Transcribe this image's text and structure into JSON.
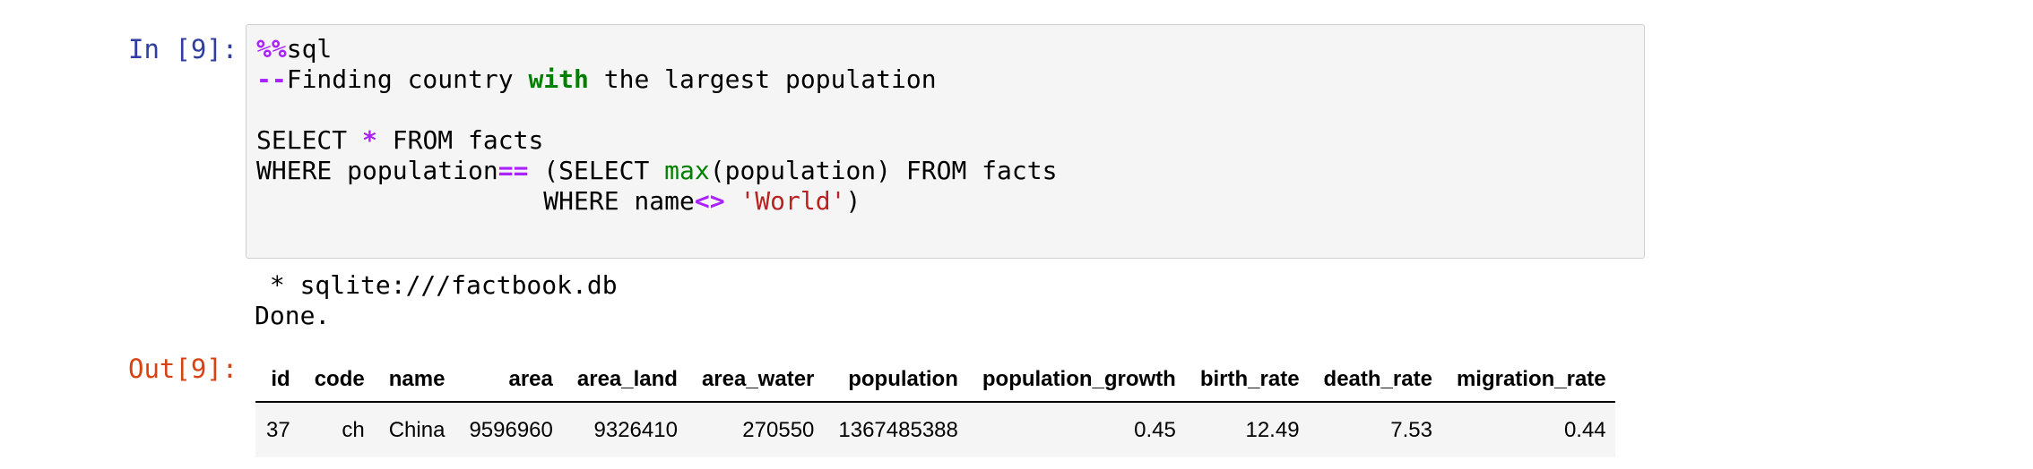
{
  "cell_in": {
    "prompt": "In [9]:",
    "lines": [
      {
        "magic": "%%",
        "rest": "sql"
      },
      {
        "op": "--",
        "a": "Finding country ",
        "kw": "with",
        "b": " the largest population"
      },
      {
        "a": "SELECT ",
        "op": "*",
        "b": " FROM facts"
      },
      {
        "a": "WHERE population",
        "op": "==",
        "b": " (SELECT ",
        "fn": "max",
        "c": "(population) FROM facts"
      },
      {
        "a": "                   WHERE name",
        "op": "<>",
        "b": " ",
        "str": "'World'",
        "c": ")"
      }
    ]
  },
  "output": {
    "stdout": [
      " * sqlite:///factbook.db",
      "Done."
    ],
    "prompt": "Out[9]:",
    "table": {
      "columns": [
        "id",
        "code",
        "name",
        "area",
        "area_land",
        "area_water",
        "population",
        "population_growth",
        "birth_rate",
        "death_rate",
        "migration_rate"
      ],
      "rows": [
        [
          "37",
          "ch",
          "China",
          "9596960",
          "9326410",
          "270550",
          "1367485388",
          "0.45",
          "12.49",
          "7.53",
          "0.44"
        ]
      ]
    }
  }
}
